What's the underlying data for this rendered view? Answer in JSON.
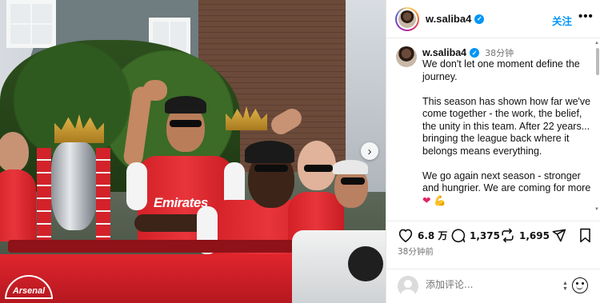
{
  "post": {
    "username": "w.saliba4",
    "follow_label": "关注",
    "more_label": "•••",
    "next_label": "›"
  },
  "caption": {
    "username": "w.saliba4",
    "time": "38分钟",
    "paragraph_1": "We don't let one moment define the journey.",
    "paragraph_2": "This season has shown how far we've come together - the work, the belief, the unity in this team. After 22 years... bringing the league back where it belongs means everything.",
    "paragraph_3": "We go again next season - stronger and hungrier. We are coming for more",
    "heart_emoji": "❤",
    "arm_emoji": "💪"
  },
  "actions": {
    "likes": "6.8 万",
    "comments": "1,375",
    "reposts": "1,695",
    "posted_ago": "38分钟前"
  },
  "comment": {
    "placeholder": "添加评论..."
  },
  "photo": {
    "bus_logo": "Arsenal",
    "sponsor_text": "Emirates"
  },
  "colors": {
    "accent": "#0095f6",
    "arsenal_red": "#e1252d"
  }
}
